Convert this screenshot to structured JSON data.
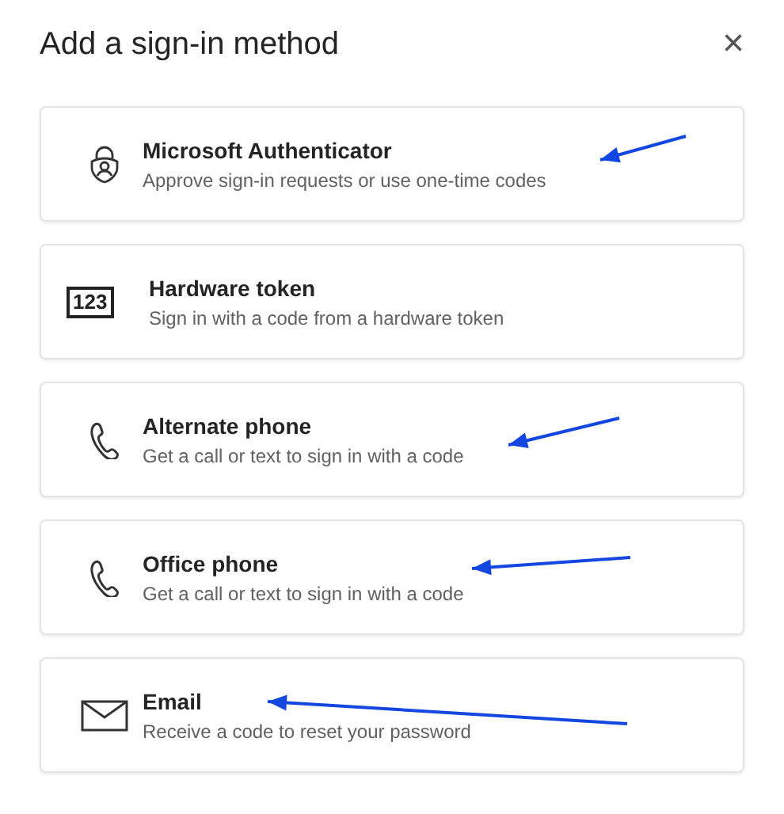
{
  "dialog": {
    "title": "Add a sign-in method",
    "close": "×"
  },
  "methods": [
    {
      "kind": "authenticator",
      "title": "Microsoft Authenticator",
      "description": "Approve sign-in requests or use one-time codes",
      "arrow": true
    },
    {
      "kind": "token",
      "icon_text": "123",
      "title": "Hardware token",
      "description": "Sign in with a code from a hardware token",
      "arrow": false
    },
    {
      "kind": "phone",
      "title": "Alternate phone",
      "description": "Get a call or text to sign in with a code",
      "arrow": true
    },
    {
      "kind": "phone",
      "title": "Office phone",
      "description": "Get a call or text to sign in with a code",
      "arrow": true
    },
    {
      "kind": "email",
      "title": "Email",
      "description": "Receive a code to reset your password",
      "arrow": true
    }
  ]
}
